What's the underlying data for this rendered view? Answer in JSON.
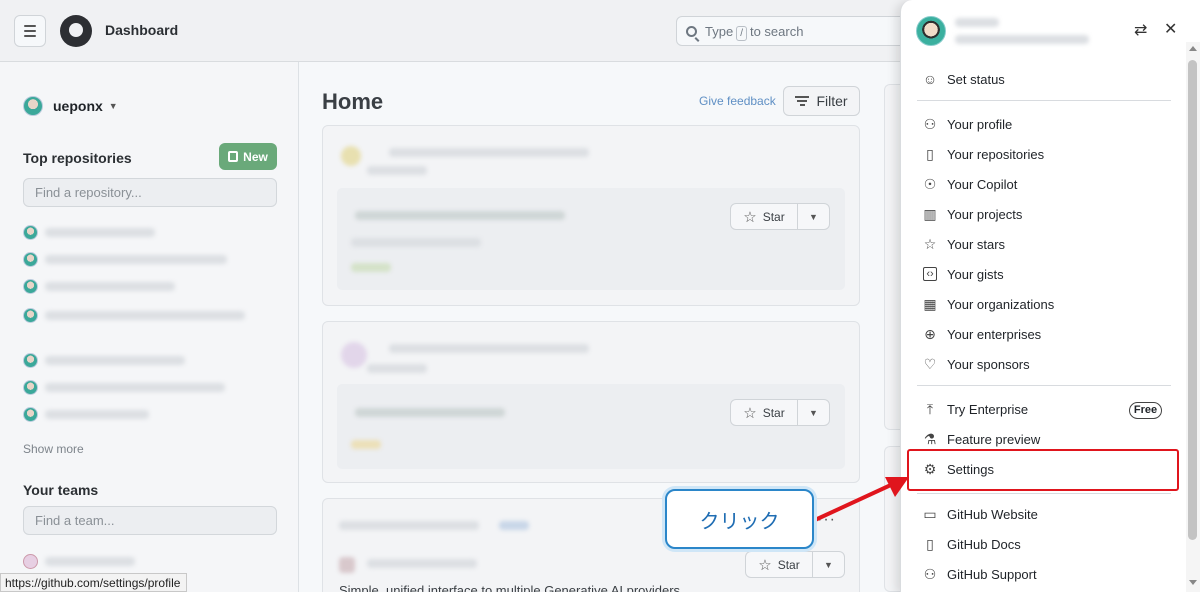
{
  "header": {
    "title": "Dashboard",
    "search_prefix": "Type",
    "search_key": "/",
    "search_suffix": "to search"
  },
  "sidebar": {
    "username": "ueponx",
    "top_repos_title": "Top repositories",
    "new_button": "New",
    "find_repo_placeholder": "Find a repository...",
    "show_more": "Show more",
    "teams_title": "Your teams",
    "find_team_placeholder": "Find a team..."
  },
  "main": {
    "title": "Home",
    "give_feedback": "Give feedback",
    "filter": "Filter",
    "star_label": "Star",
    "trending_desc": "Simple, unified interface to multiple Generative AI providers"
  },
  "status_url": "https://github.com/settings/profile",
  "menu": {
    "items": [
      {
        "label": "Set status",
        "icon": "smiley-icon"
      },
      {
        "label": "Your profile",
        "icon": "person-icon"
      },
      {
        "label": "Your repositories",
        "icon": "repo-icon"
      },
      {
        "label": "Your Copilot",
        "icon": "copilot-icon"
      },
      {
        "label": "Your projects",
        "icon": "project-icon"
      },
      {
        "label": "Your stars",
        "icon": "star-icon"
      },
      {
        "label": "Your gists",
        "icon": "code-square-icon"
      },
      {
        "label": "Your organizations",
        "icon": "organization-icon"
      },
      {
        "label": "Your enterprises",
        "icon": "globe-icon"
      },
      {
        "label": "Your sponsors",
        "icon": "heart-icon"
      },
      {
        "label": "Try Enterprise",
        "icon": "upload-icon"
      },
      {
        "label": "Feature preview",
        "icon": "beaker-icon"
      },
      {
        "label": "Settings",
        "icon": "gear-icon"
      },
      {
        "label": "GitHub Website",
        "icon": "browser-icon"
      },
      {
        "label": "GitHub Docs",
        "icon": "book-icon"
      },
      {
        "label": "GitHub Support",
        "icon": "people-icon"
      }
    ],
    "free_badge": "Free"
  },
  "callout_text": "クリック",
  "colors": {
    "highlight": "#e0151d",
    "callout_border": "#2b86c9",
    "new_button": "#6aa97a"
  }
}
